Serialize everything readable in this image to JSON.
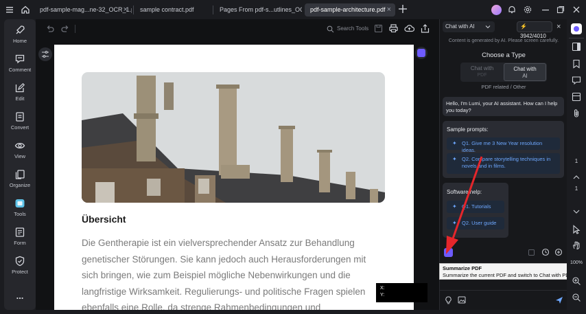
{
  "tabs": [
    {
      "label": "pdf-sample-mag...ne-32_OCR_1.pdf",
      "active": false
    },
    {
      "label": "sample contract.pdf",
      "active": false
    },
    {
      "label": "Pages From pdf-s...utlines_OCR.pdf",
      "active": false
    },
    {
      "label": "pdf-sample-architecture.pdf",
      "active": true
    }
  ],
  "sidebar": {
    "items": [
      {
        "label": "Home",
        "icon": "rocket-icon"
      },
      {
        "label": "Comment",
        "icon": "comment-icon"
      },
      {
        "label": "Edit",
        "icon": "edit-icon"
      },
      {
        "label": "Convert",
        "icon": "convert-icon"
      },
      {
        "label": "View",
        "icon": "eye-icon"
      },
      {
        "label": "Organize",
        "icon": "organize-icon"
      },
      {
        "label": "Tools",
        "icon": "tools-icon"
      },
      {
        "label": "Form",
        "icon": "form-icon"
      },
      {
        "label": "Protect",
        "icon": "shield-icon"
      }
    ],
    "more": "..."
  },
  "toolbar": {
    "search_label": "Search Tools"
  },
  "document": {
    "heading": "Übersicht",
    "lines": [
      "Die Gentherapie ist ein vielversprechender Ansatz zur Behandlung",
      "genetischer Störungen. Sie kann jedoch auch Herausforderungen mit",
      "sich bringen, wie zum Beispiel mögliche Nebenwirkungen und die",
      "langfristige Wirksamkeit. Regulierungs- und politische Fragen spielen",
      "ebenfalls eine Rolle, da strenge Rahmenbedingungen und"
    ]
  },
  "coords": {
    "x_label": "X:",
    "y_label": "Y:"
  },
  "ai": {
    "mode_select": "Chat with AI",
    "credits": "3942/4010",
    "disclaimer": "Content is generated by AI. Please screen carefully.",
    "choose_type_title": "Choose a Type",
    "type_options": [
      {
        "line1": "Chat with",
        "line2": "PDF",
        "selected": false
      },
      {
        "line1": "Chat with",
        "line2": "AI",
        "selected": true
      }
    ],
    "related_text": "PDF related / Other",
    "greeting": "Hello, I'm Lumi, your AI assistant. How can I help you today?",
    "sample_prompts_title": "Sample prompts:",
    "sample_prompts": [
      "Q1. Give me 3 New Year resolution ideas.",
      "Q2. Compare storytelling techniques in novels and in films."
    ],
    "software_help_title": "Software help:",
    "software_help": [
      "Q1. Tutorials",
      "Q2. User guide"
    ]
  },
  "tooltip": {
    "title": "Summarize PDF",
    "text": "Summarize the current PDF and switch to Chat with PDF here."
  },
  "right_rail": {
    "page_number": "1",
    "page_number_2": "1",
    "zoom": "100%"
  },
  "colors": {
    "accent": "#6e5bff",
    "annotation_arrow": "#e5262b"
  }
}
